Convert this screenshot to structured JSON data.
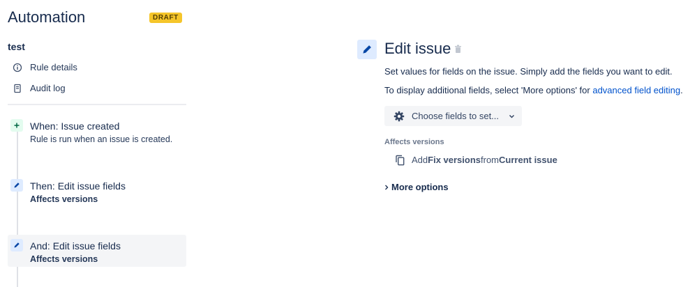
{
  "header": {
    "title": "Automation",
    "badge": "DRAFT"
  },
  "rule": {
    "name": "test",
    "nav": [
      {
        "label": "Rule details",
        "icon": "info-icon"
      },
      {
        "label": "Audit log",
        "icon": "document-icon"
      }
    ]
  },
  "steps": [
    {
      "title": "When: Issue created",
      "subtitle": "Rule is run when an issue is created.",
      "icon": "plus-icon"
    },
    {
      "title": "Then: Edit issue fields",
      "subtitle": "Affects versions",
      "icon": "pencil-icon"
    },
    {
      "title": "And: Edit issue fields",
      "subtitle": "Affects versions",
      "icon": "pencil-icon",
      "selected": true
    }
  ],
  "panel": {
    "title": "Edit issue",
    "description": "Set values for fields on the issue. Simply add the fields you want to edit.",
    "hint_prefix": "To display additional fields, select 'More options' for ",
    "hint_link": "advanced field editing",
    "hint_suffix": ".",
    "choose_button": "Choose fields to set...",
    "field_label": "Affects versions",
    "field_value": {
      "p1": "Add ",
      "b1": "Fix versions",
      "p2": " from ",
      "b2": "Current issue"
    },
    "more_options": "More options"
  },
  "colors": {
    "accent": "#0052cc",
    "badge": "#f5c52a",
    "selected_bg": "#f4f5f7"
  }
}
